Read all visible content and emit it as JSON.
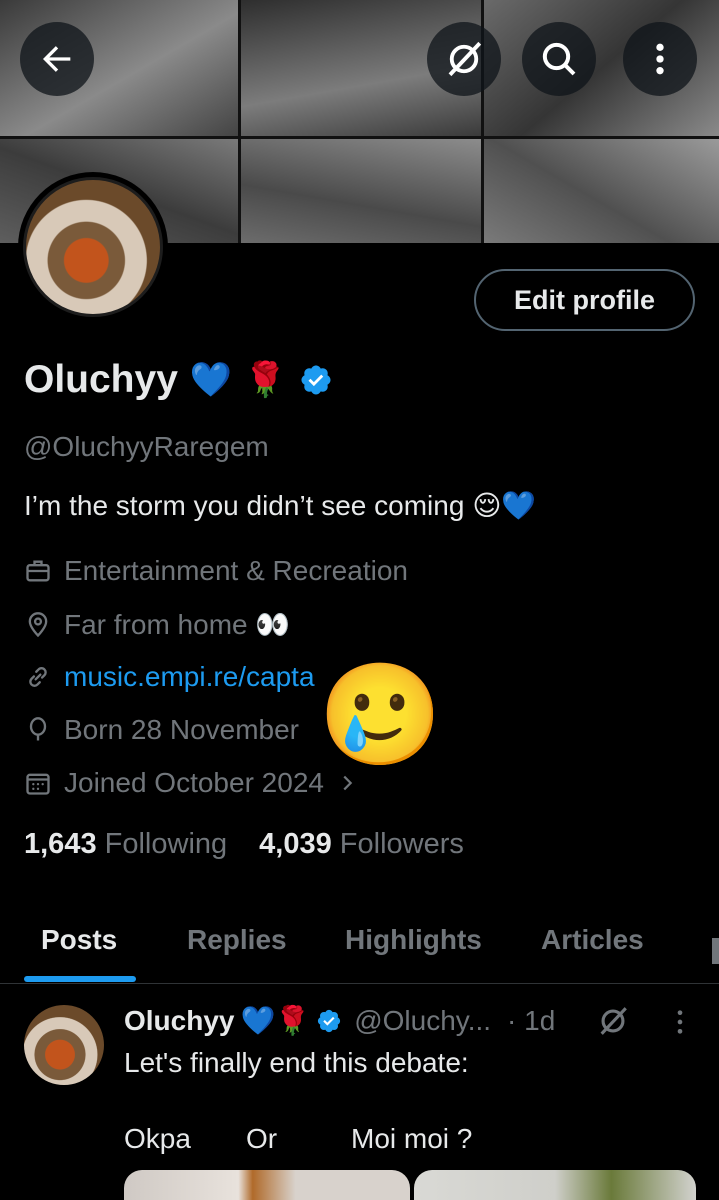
{
  "header": {
    "back_icon": "arrow-left-icon",
    "grok_icon": "grok-icon",
    "search_icon": "search-icon",
    "more_icon": "more-vertical-icon"
  },
  "profile": {
    "edit_label": "Edit profile",
    "display_name": "Oluchyy",
    "name_emojis": [
      "💙",
      "🌹"
    ],
    "handle": "@OluchyyRaregem",
    "bio": "I’m the storm you didn’t see coming 😌💙",
    "category": "Entertainment & Recreation",
    "location": "Far from home 👀",
    "website": "music.empi.re/capta",
    "birthday": "Born 28 November",
    "joined": "Joined October 2024",
    "sticker": "🥲",
    "following_count": "1,643",
    "following_label": "Following",
    "followers_count": "4,039",
    "followers_label": "Followers"
  },
  "tabs": [
    "Posts",
    "Replies",
    "Highlights",
    "Articles"
  ],
  "active_tab": "Posts",
  "post": {
    "name": "Oluchyy",
    "name_emojis": "💙🌹",
    "handle": "@Oluchy...",
    "time": "· 1d",
    "text": "Let's finally end this debate:",
    "option1": "Okpa",
    "option_or": "Or",
    "option2": "Moi moi ?"
  },
  "colors": {
    "accent": "#1d9bf0",
    "text_primary": "#e7e9ea",
    "text_secondary": "#71767b",
    "background": "#000000"
  }
}
